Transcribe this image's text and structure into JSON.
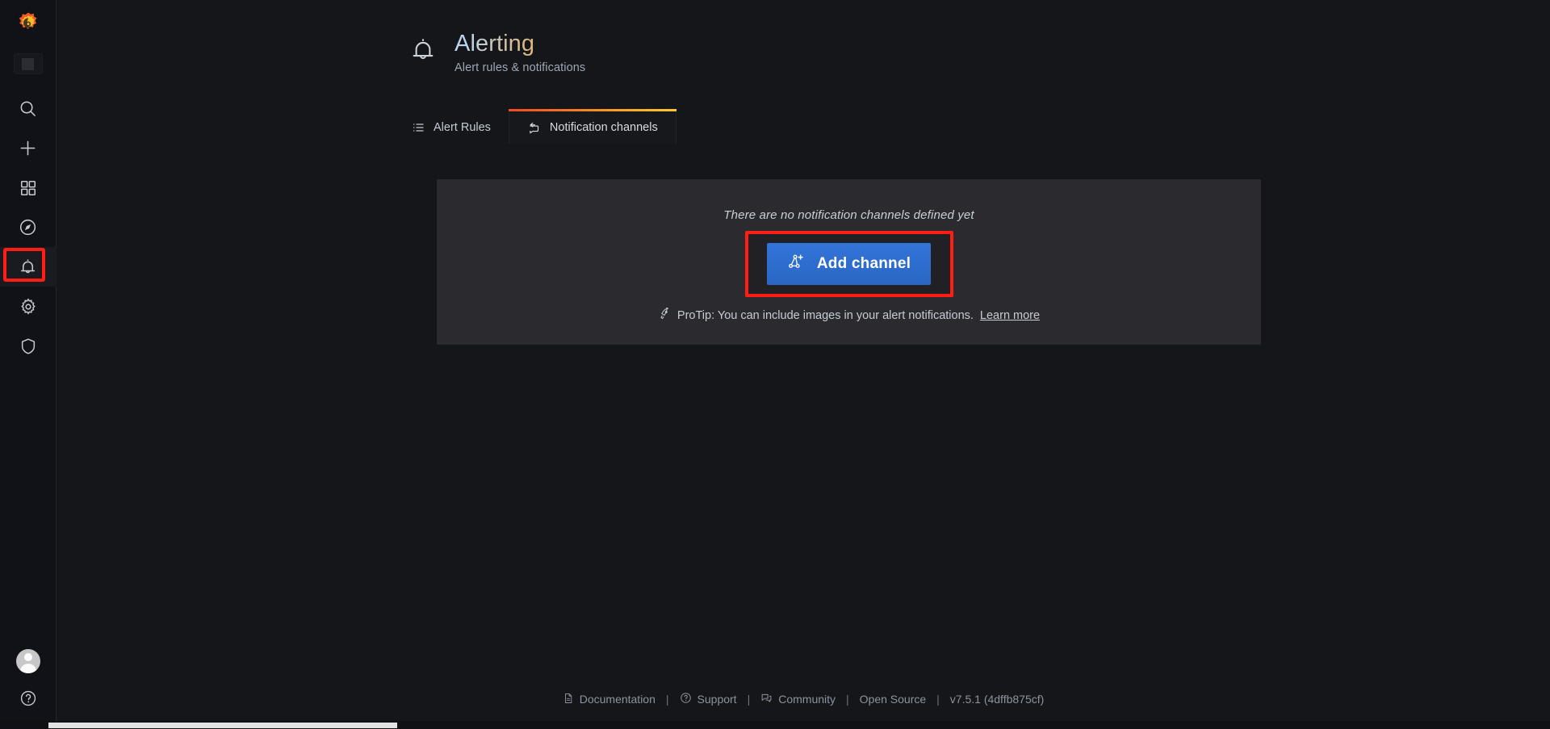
{
  "sidebar": {
    "logo_icon": "grafana-logo-icon",
    "org_chip_icon": "org-square-icon",
    "items": [
      {
        "name": "search",
        "icon": "search-icon",
        "label": "Search dashboards",
        "active": false
      },
      {
        "name": "create",
        "icon": "plus-icon",
        "label": "Create",
        "active": false
      },
      {
        "name": "dashboards",
        "icon": "apps-grid-icon",
        "label": "Dashboards",
        "active": false
      },
      {
        "name": "explore",
        "icon": "compass-icon",
        "label": "Explore",
        "active": false
      },
      {
        "name": "alerting",
        "icon": "bell-icon",
        "label": "Alerting",
        "active": true
      },
      {
        "name": "configuration",
        "icon": "gear-icon",
        "label": "Configuration",
        "active": false
      },
      {
        "name": "server-admin",
        "icon": "shield-icon",
        "label": "Server Admin",
        "active": false
      }
    ],
    "bottom": [
      {
        "name": "user-profile",
        "icon": "avatar-icon",
        "label": "Profile"
      },
      {
        "name": "help",
        "icon": "question-circle-icon",
        "label": "Help"
      }
    ]
  },
  "header": {
    "icon": "bell-icon",
    "title": "Alerting",
    "subtitle": "Alert rules & notifications"
  },
  "tabs": [
    {
      "id": "alert-rules",
      "label": "Alert Rules",
      "icon": "list-ul-icon",
      "active": false
    },
    {
      "id": "notification-channels",
      "label": "Notification channels",
      "icon": "comment-share-icon",
      "active": true
    }
  ],
  "main": {
    "empty_state_text": "There are no notification channels defined yet",
    "add_button": {
      "label": "Add channel",
      "icon": "share-alt-add-icon"
    },
    "protip": {
      "icon": "rocket-icon",
      "text": "ProTip: You can include images in your alert notifications.",
      "link_label": "Learn more"
    }
  },
  "footer": {
    "documentation": {
      "label": "Documentation",
      "icon": "file-alt-icon"
    },
    "support": {
      "label": "Support",
      "icon": "question-circle-icon"
    },
    "community": {
      "label": "Community",
      "icon": "comments-alt-icon"
    },
    "open_source": {
      "label": "Open Source"
    },
    "version": "v7.5.1 (4dffb875cf)",
    "separator": "|"
  },
  "colors": {
    "page_background": "#141619",
    "sidebar_background": "#111217",
    "panel_background": "#2a2a2f",
    "primary_button": "#3274d9",
    "annotation_highlight": "#ff1d14",
    "tab_gradient_start": "#ef4b22",
    "tab_gradient_end": "#fbc92d",
    "text_primary": "#c6ccd4",
    "text_muted": "#8d949e"
  }
}
